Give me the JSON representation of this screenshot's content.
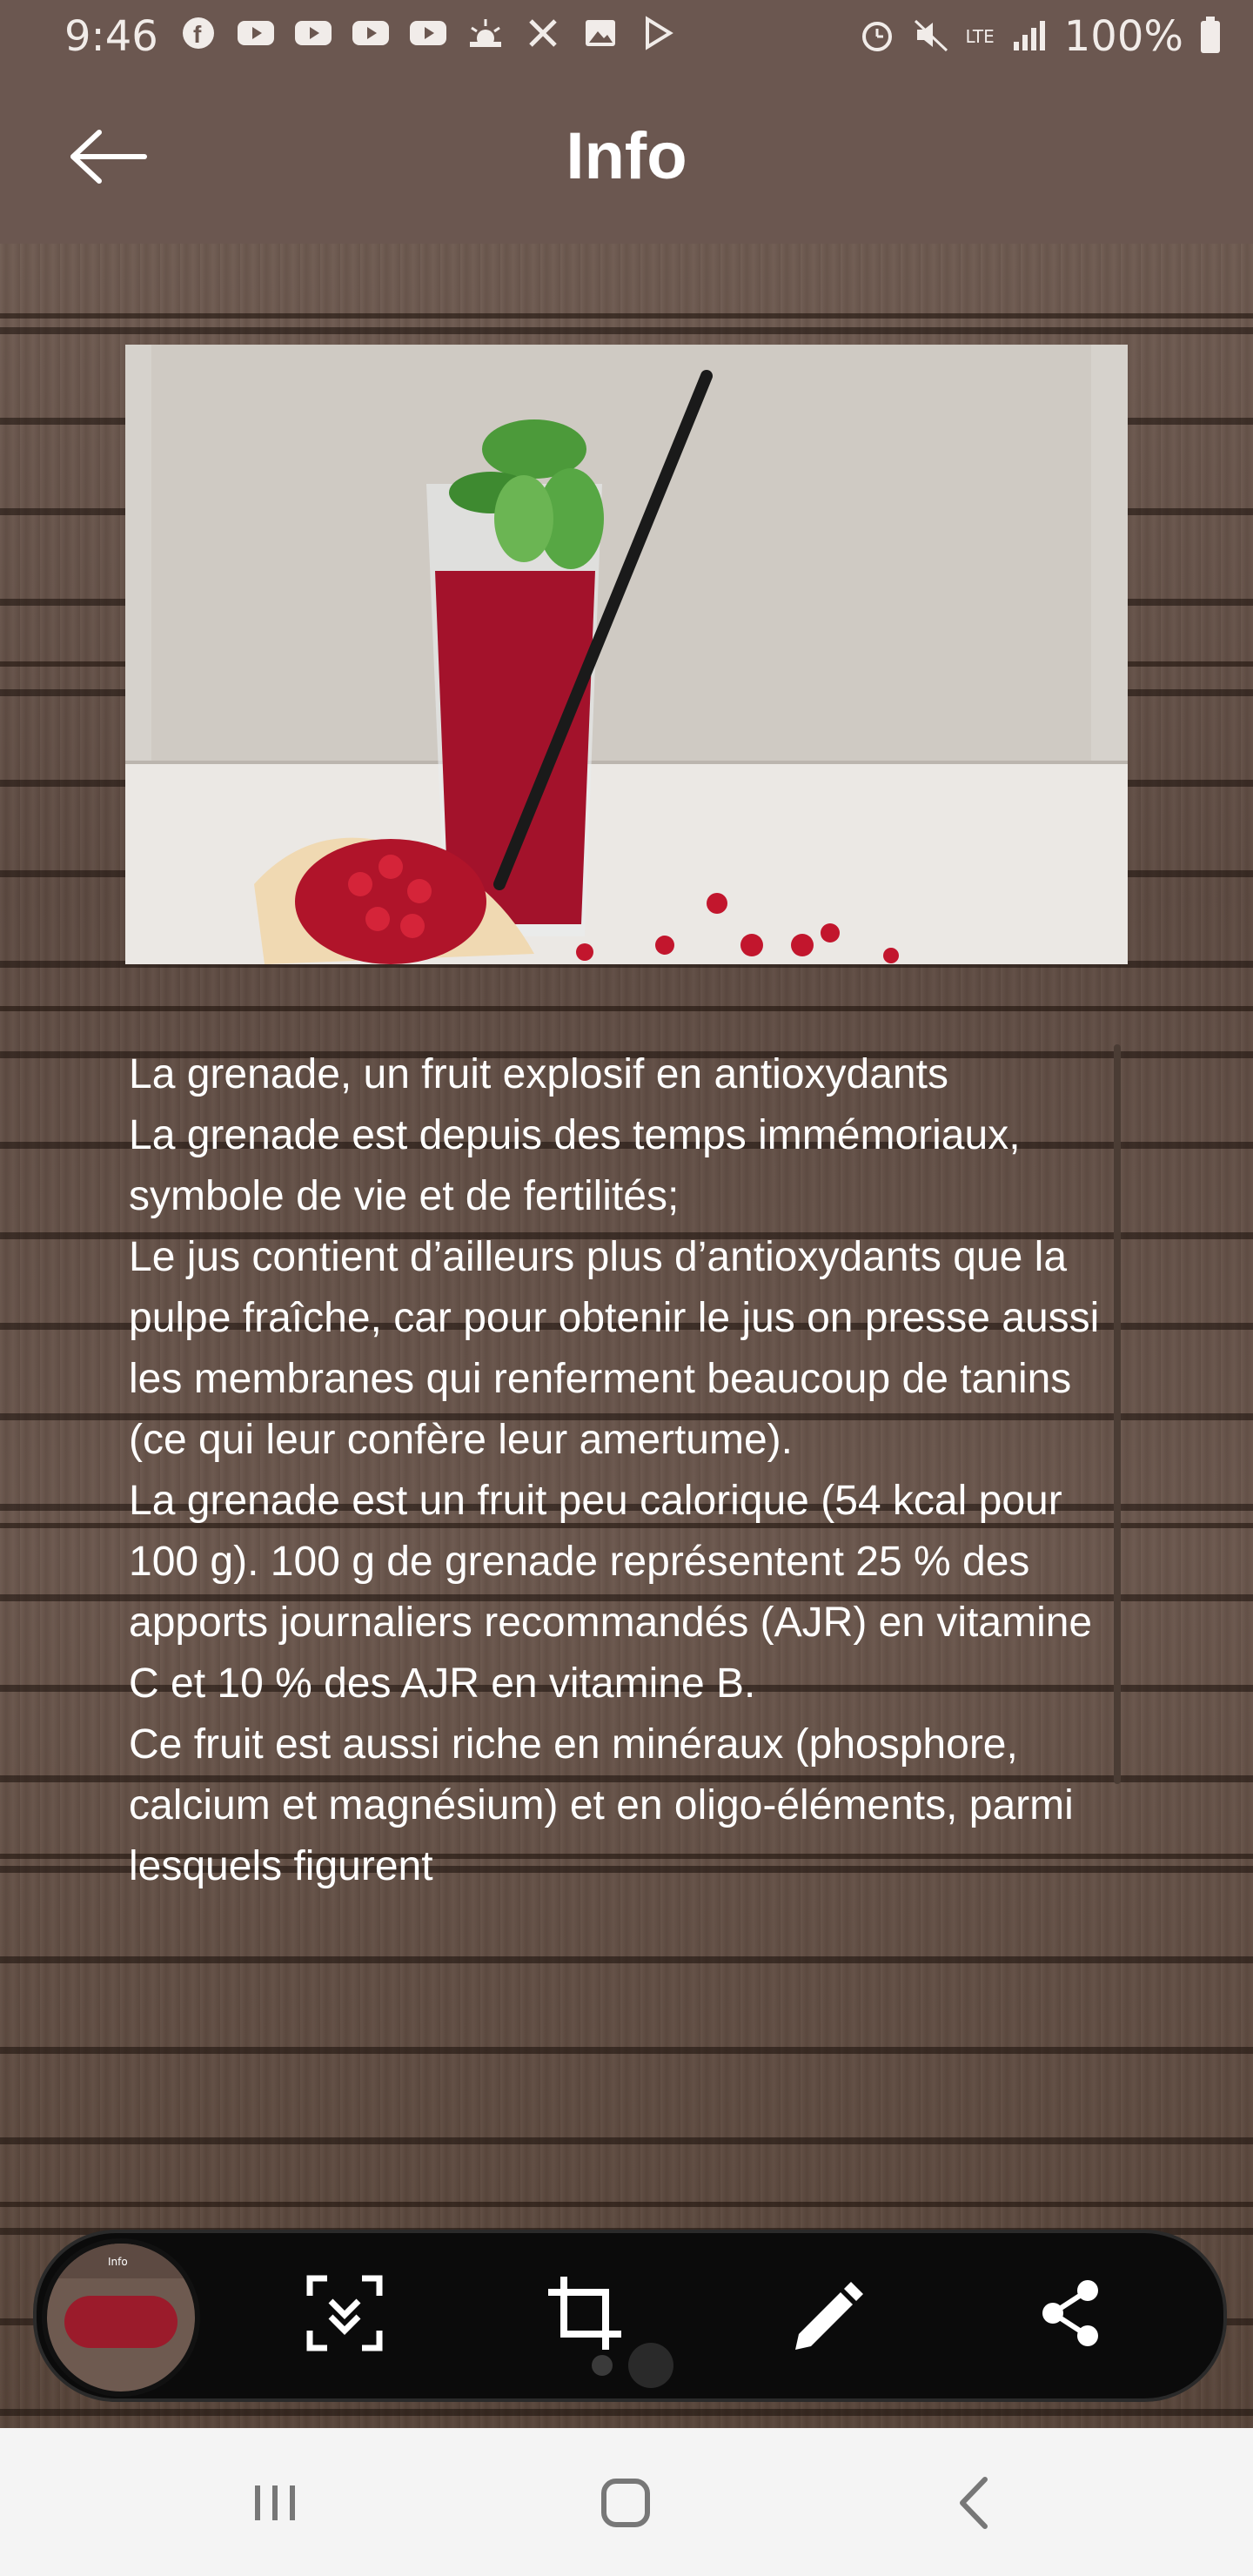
{
  "status_bar": {
    "time": "9:46",
    "battery": "100%",
    "network": "LTE",
    "left_icons": [
      "facebook-icon",
      "youtube-icon",
      "youtube-icon",
      "youtube-icon",
      "youtube-icon",
      "weather-icon",
      "tools-icon",
      "image-icon",
      "play-store-icon"
    ],
    "right_icons": [
      "alarm-icon",
      "mute-icon",
      "lte-icon",
      "signal-icon",
      "battery-icon"
    ]
  },
  "app_bar": {
    "title": "Info",
    "back_icon": "arrow-left-icon"
  },
  "hero": {
    "icon": "pomegranate-juice-image"
  },
  "article": {
    "paragraphs": [
      "La grenade, un fruit explosif en antioxydants",
      "La grenade est depuis des temps immémoriaux, symbole de vie et de fertilités;",
      "Le jus contient d’ailleurs plus d’antioxydants que la pulpe fraîche, car pour obtenir le jus on presse aussi les membranes qui renferment beaucoup de tanins (ce qui leur confère leur amertume).",
      "La grenade est un fruit peu calorique (54 kcal pour 100 g). 100 g de grenade représentent 25 % des apports journaliers recommandés (AJR) en vitamine C et 10 % des AJR en vitamine B.",
      "Ce fruit est aussi riche en minéraux (phosphore, calcium et magnésium) et en oligo-éléments, parmi lesquels figurent"
    ]
  },
  "screenshot_toolbar": {
    "thumbnail_label": "Info",
    "buttons": [
      "scroll-capture-icon",
      "crop-icon",
      "edit-icon",
      "share-icon"
    ]
  },
  "colors": {
    "app_bar": "#6b5750",
    "text": "#ffffff",
    "toolbar": "#0b0b0b",
    "nav_bar": "#f4f4f4"
  },
  "nav_bar": {
    "buttons": [
      "recent-apps-icon",
      "home-icon",
      "back-icon"
    ]
  }
}
